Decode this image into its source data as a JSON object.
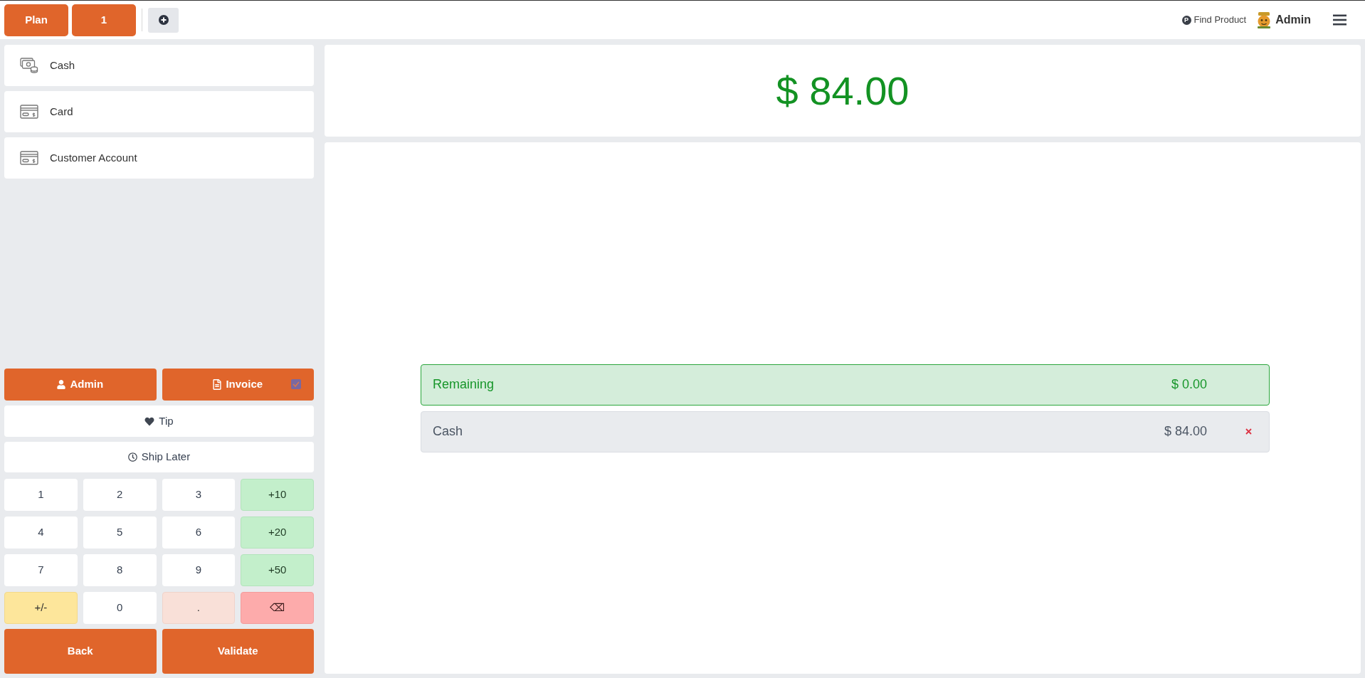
{
  "top_bar": {
    "buttons": [
      "Plan",
      "1"
    ],
    "find_product": {
      "icon": "P",
      "label": "Find Product"
    },
    "user": "Admin"
  },
  "payment_methods": [
    {
      "kind": "cash",
      "label": "Cash"
    },
    {
      "kind": "card",
      "label": "Card"
    },
    {
      "kind": "card",
      "label": "Customer Account"
    }
  ],
  "actions": {
    "customer": "Admin",
    "invoice": {
      "label": "Invoice",
      "checked": true
    },
    "tip": "Tip",
    "ship_later": "Ship Later"
  },
  "numpad": [
    {
      "kind": "digit",
      "label": "1"
    },
    {
      "kind": "digit",
      "label": "2"
    },
    {
      "kind": "digit",
      "label": "3"
    },
    {
      "kind": "quick",
      "label": "+10"
    },
    {
      "kind": "digit",
      "label": "4"
    },
    {
      "kind": "digit",
      "label": "5"
    },
    {
      "kind": "digit",
      "label": "6"
    },
    {
      "kind": "quick",
      "label": "+20"
    },
    {
      "kind": "digit",
      "label": "7"
    },
    {
      "kind": "digit",
      "label": "8"
    },
    {
      "kind": "digit",
      "label": "9"
    },
    {
      "kind": "quick",
      "label": "+50"
    },
    {
      "kind": "sign",
      "label": "+/-"
    },
    {
      "kind": "digit",
      "label": "0"
    },
    {
      "kind": "decimal",
      "label": "."
    },
    {
      "kind": "backspace",
      "label": "⌫"
    }
  ],
  "footer_buttons": [
    "Back",
    "Validate"
  ],
  "amount": "$ 84.00",
  "payment_lines": [
    {
      "kind": "remaining",
      "label": "Remaining",
      "amount": "$ 0.00"
    },
    {
      "kind": "payment",
      "label": "Cash",
      "amount": "$ 84.00"
    }
  ]
}
